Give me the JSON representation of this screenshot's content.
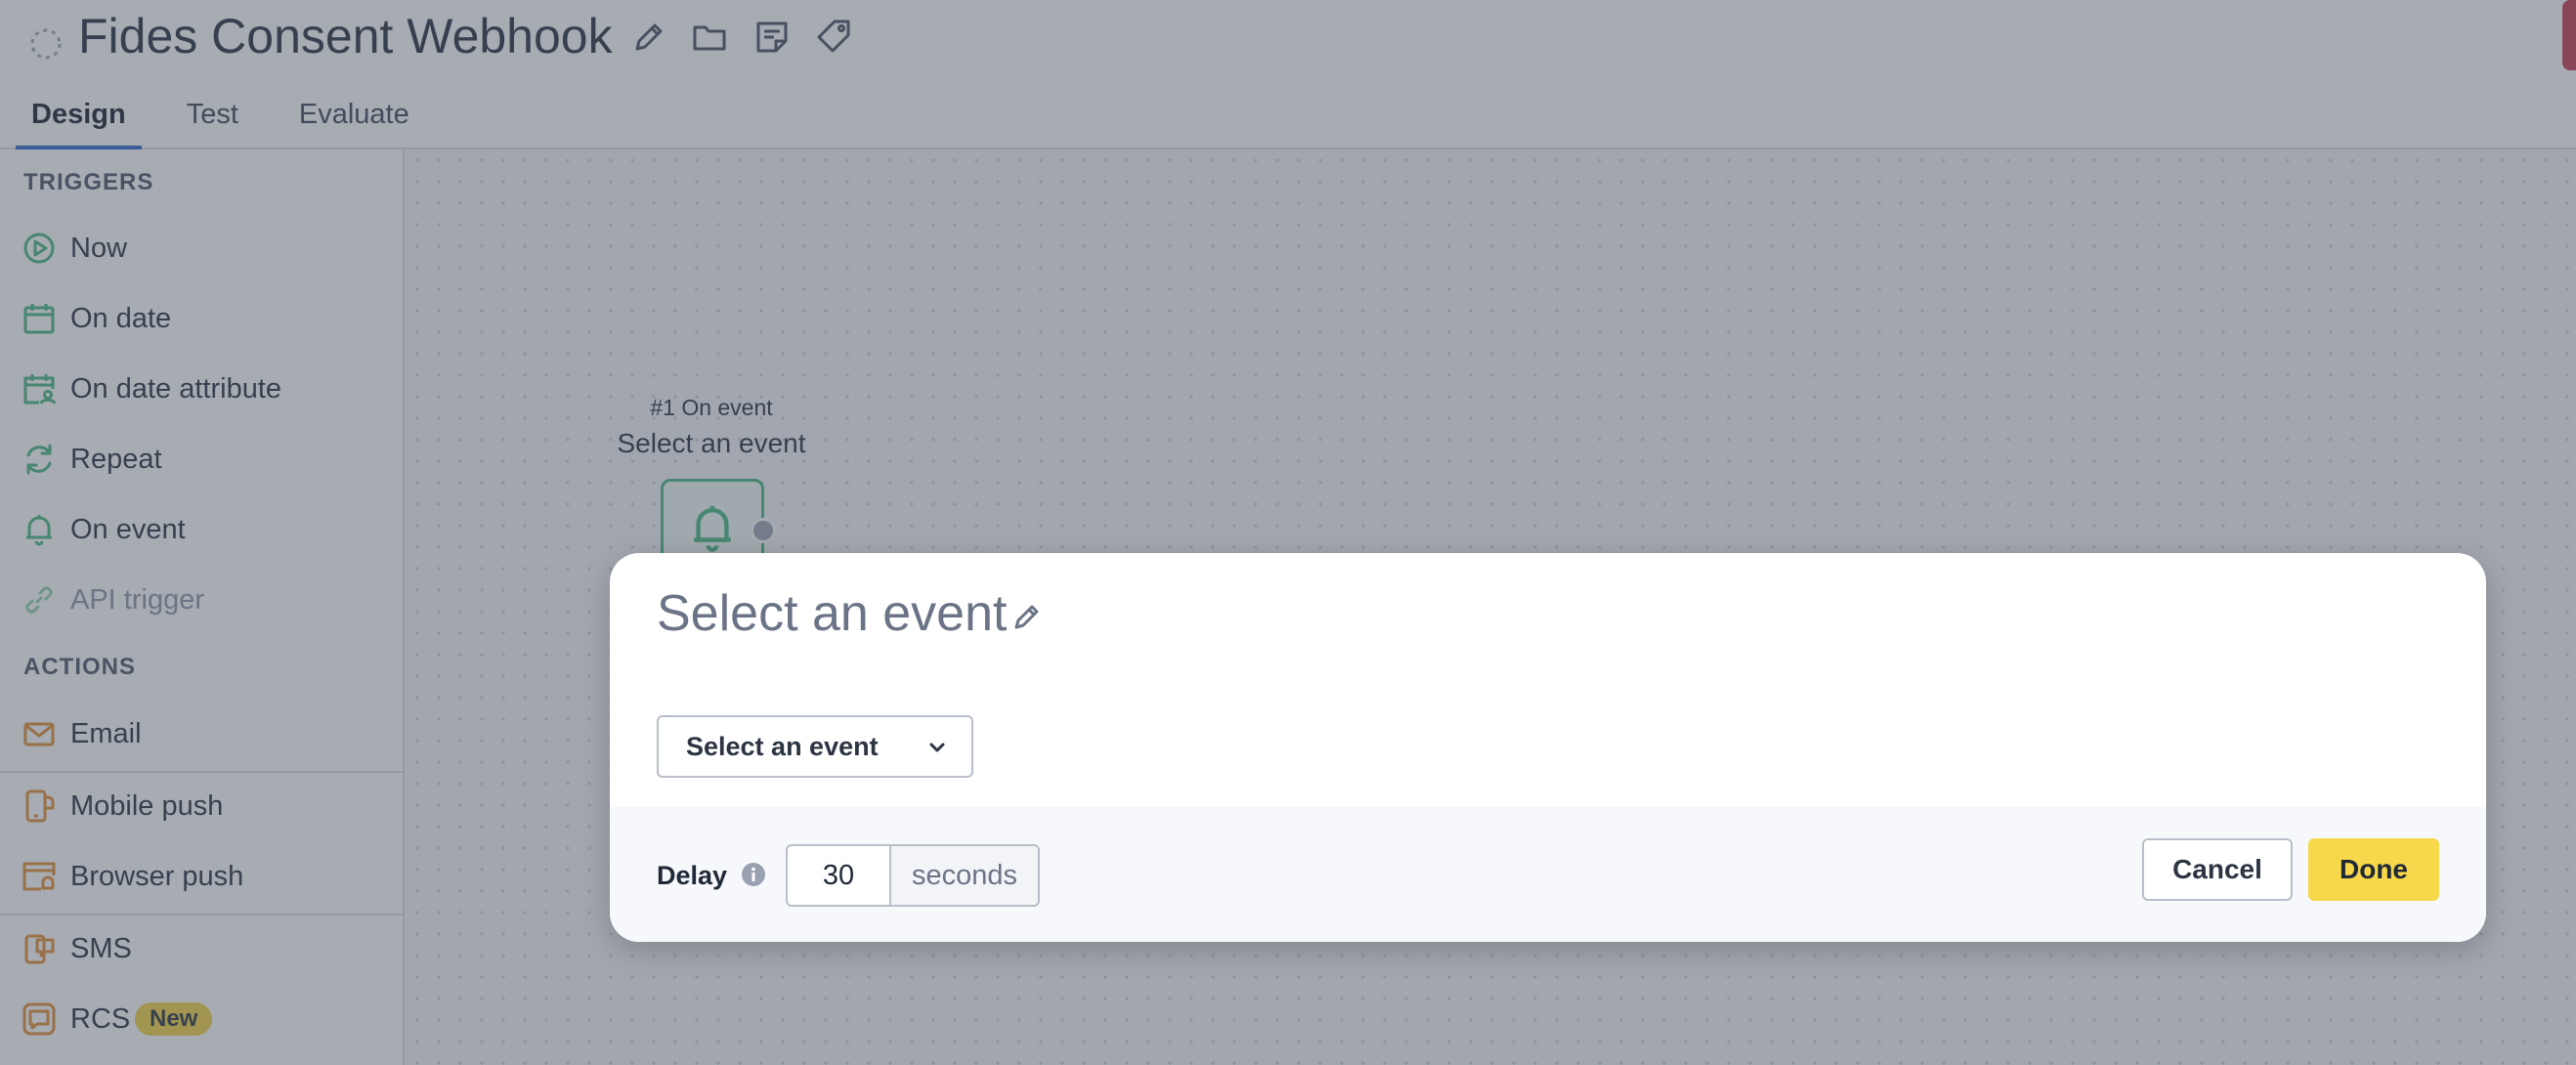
{
  "header": {
    "title": "Fides Consent Webhook",
    "icons": [
      "edit-pencil-icon",
      "folder-icon",
      "note-icon",
      "tag-icon"
    ]
  },
  "tabs": [
    {
      "label": "Design",
      "active": true
    },
    {
      "label": "Test",
      "active": false
    },
    {
      "label": "Evaluate",
      "active": false
    }
  ],
  "sidebar": {
    "triggers_label": "TRIGGERS",
    "triggers": [
      {
        "label": "Now",
        "icon": "play-circle-icon"
      },
      {
        "label": "On date",
        "icon": "calendar-icon"
      },
      {
        "label": "On date attribute",
        "icon": "calendar-person-icon"
      },
      {
        "label": "Repeat",
        "icon": "repeat-icon"
      },
      {
        "label": "On event",
        "icon": "bell-icon"
      },
      {
        "label": "API trigger",
        "icon": "link-icon",
        "disabled": true
      }
    ],
    "actions_label": "ACTIONS",
    "actions": [
      {
        "label": "Email",
        "icon": "envelope-icon"
      },
      {
        "label": "Mobile push",
        "icon": "mobile-bell-icon"
      },
      {
        "label": "Browser push",
        "icon": "browser-bell-icon"
      },
      {
        "label": "SMS",
        "icon": "sms-icon"
      },
      {
        "label": "RCS",
        "icon": "chat-icon",
        "badge": "New"
      }
    ]
  },
  "canvas": {
    "node": {
      "caption": "#1 On event",
      "title": "Select an event",
      "icon": "bell-icon"
    }
  },
  "modal": {
    "title": "Select an event",
    "event_select": {
      "value": "Select an event"
    },
    "delay": {
      "label": "Delay",
      "value": "30",
      "unit": "seconds"
    },
    "cancel_label": "Cancel",
    "done_label": "Done"
  },
  "colors": {
    "trigger_green": "#3fb57b",
    "action_orange": "#e08a2c",
    "accent_blue": "#2563c9",
    "done_yellow": "#f7d84a",
    "badge_yellow": "#f2d33d",
    "alert_red": "#c2354d"
  }
}
